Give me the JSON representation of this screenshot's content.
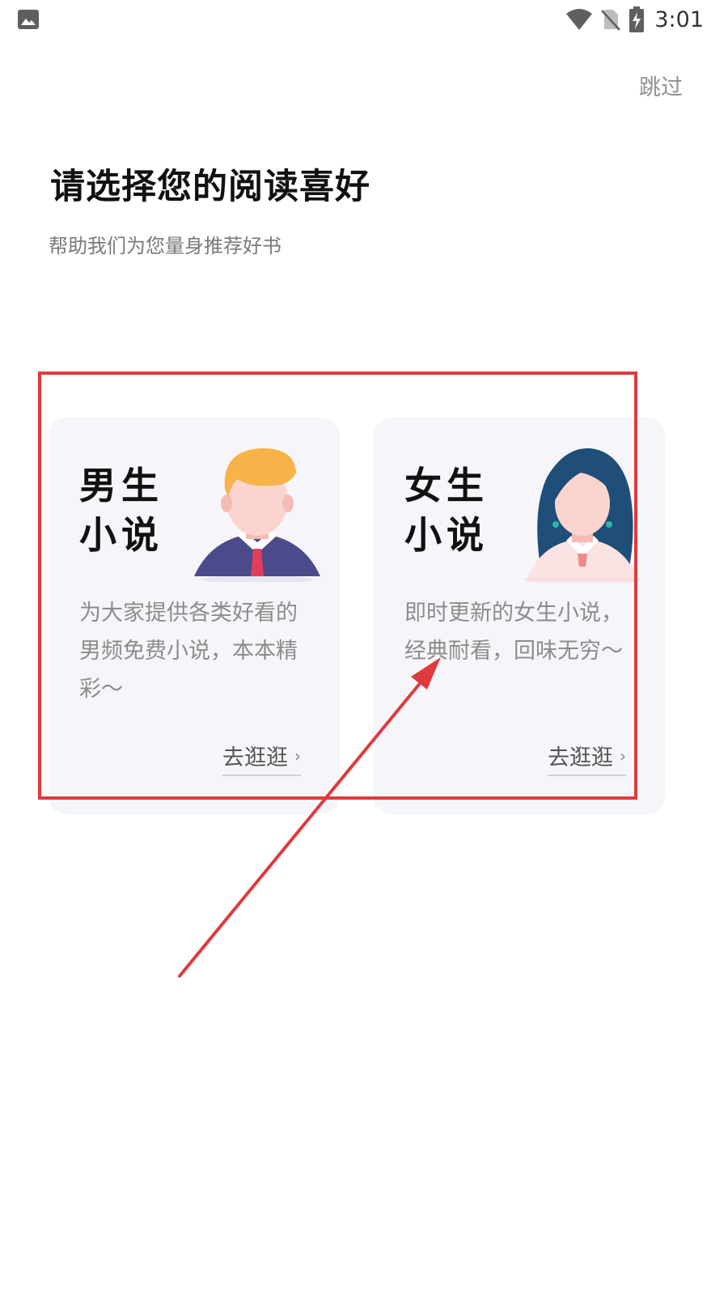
{
  "status_bar": {
    "time": "3:01",
    "icons": [
      "gallery-icon",
      "wifi-icon",
      "no-sim-icon",
      "battery-charging-icon"
    ]
  },
  "header": {
    "skip_label": "跳过",
    "title": "请选择您的阅读喜好",
    "subtitle": "帮助我们为您量身推荐好书"
  },
  "cards": [
    {
      "title_line1": "男生",
      "title_line2": "小说",
      "description": "为大家提供各类好看的男频免费小说，本本精彩～",
      "link_label": "去逛逛",
      "illustration": "male-avatar-icon"
    },
    {
      "title_line1": "女生",
      "title_line2": "小说",
      "description": "即时更新的女生小说，经典耐看，回味无穷～",
      "link_label": "去逛逛",
      "illustration": "female-avatar-icon"
    }
  ],
  "colors": {
    "annotation": "#e03a3e",
    "card_bg": "#f6f6fa",
    "male_hair": "#f7b24a",
    "male_suit": "#4b4a8a",
    "female_hair": "#1f4e79",
    "skin": "#fcd4cf"
  }
}
